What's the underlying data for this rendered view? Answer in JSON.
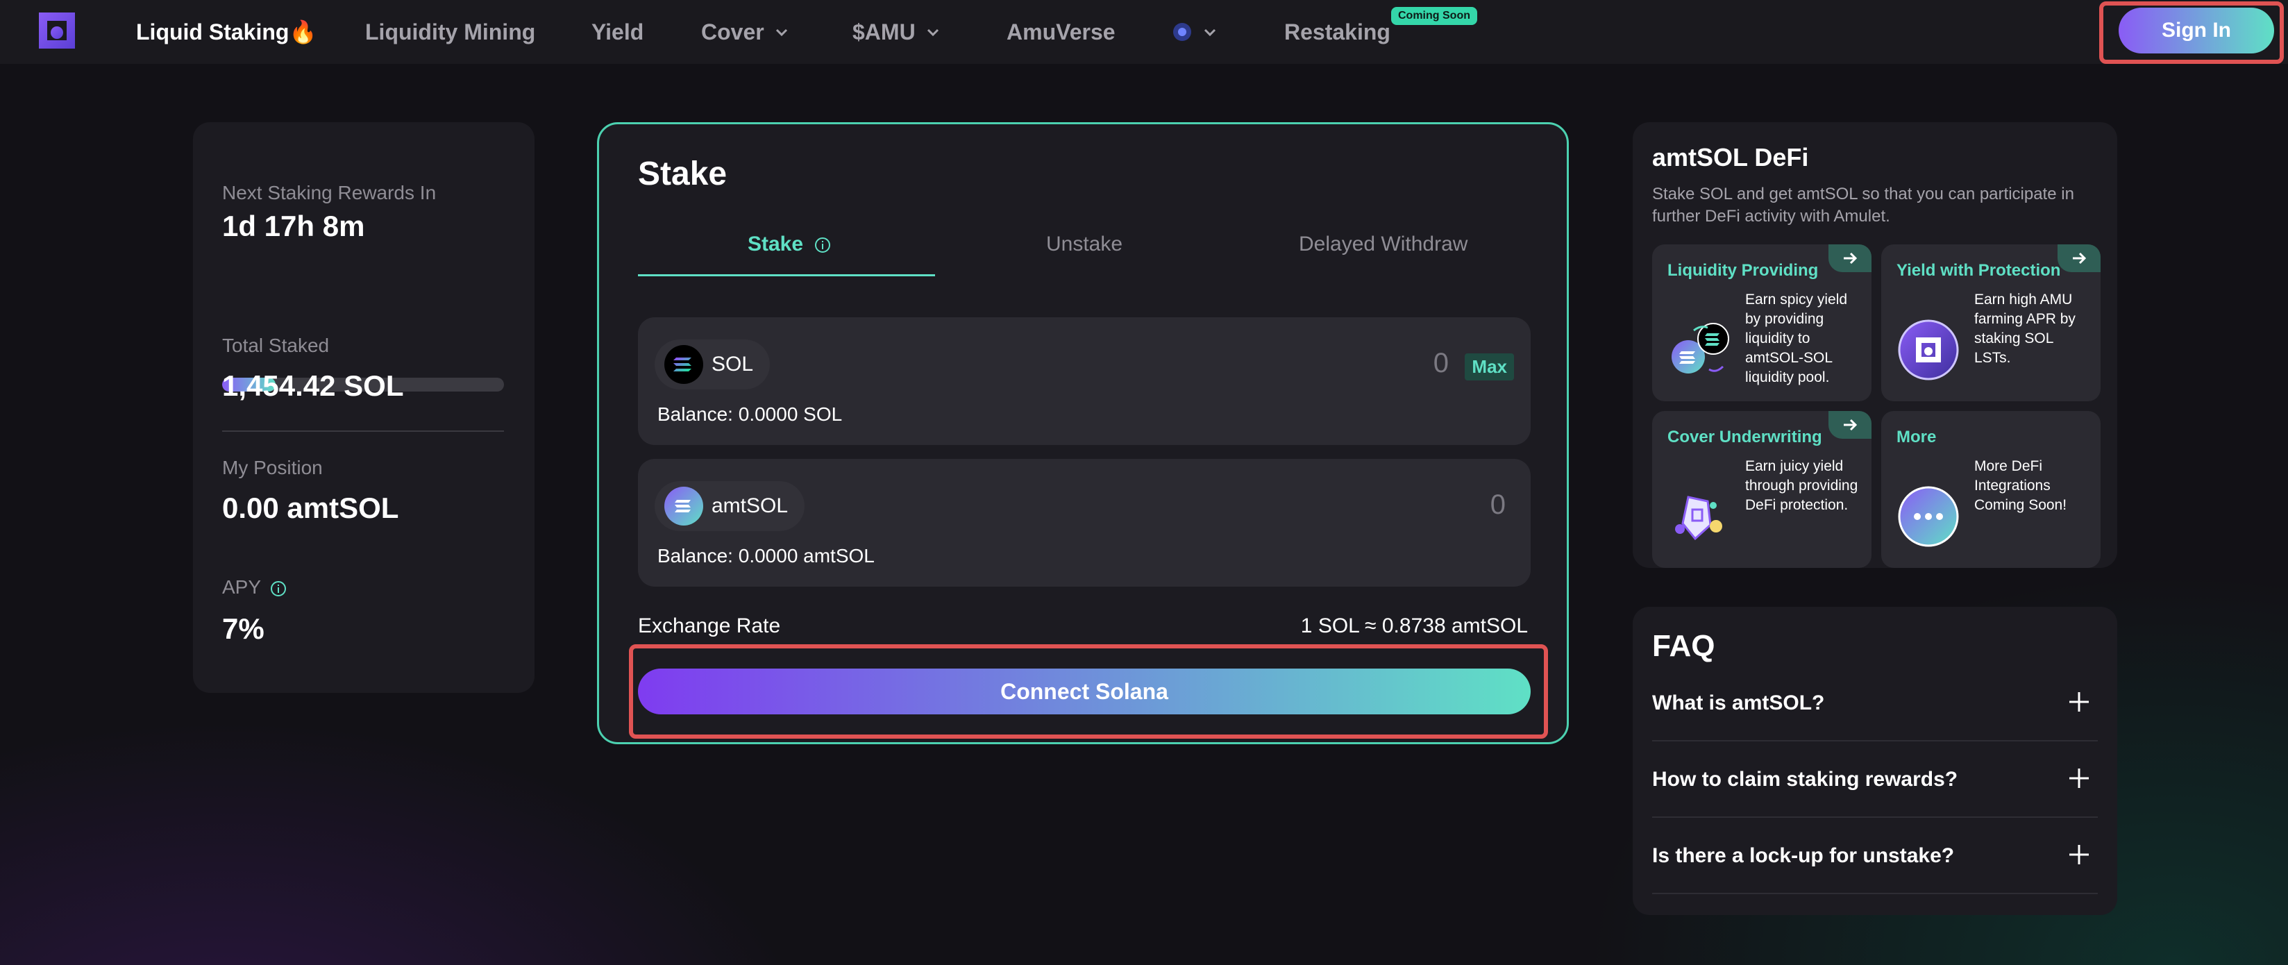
{
  "nav": {
    "items": [
      {
        "label": "Liquid Staking🔥"
      },
      {
        "label": "Liquidity Mining"
      },
      {
        "label": "Yield"
      },
      {
        "label": "Cover"
      },
      {
        "label": "$AMU"
      },
      {
        "label": "AmuVerse"
      },
      {
        "label": ""
      },
      {
        "label": "Restaking"
      }
    ],
    "coming_soon": "Coming Soon",
    "sign_in": "Sign In"
  },
  "stats": {
    "next_rewards_label": "Next Staking Rewards In",
    "next_rewards_value": "1d 17h 8m",
    "progress": 0.19,
    "total_staked_label": "Total Staked",
    "total_staked_value": "1,454.42 SOL",
    "position_label": "My Position",
    "position_value": "0.00 amtSOL",
    "apy_label": "APY",
    "apy_value": "7%"
  },
  "stake": {
    "title": "Stake",
    "tabs": [
      "Stake",
      "Unstake",
      "Delayed Withdraw"
    ],
    "from": {
      "token": "SOL",
      "amount": "0",
      "max": "Max",
      "balance": "Balance: 0.0000 SOL"
    },
    "to": {
      "token": "amtSOL",
      "amount": "0",
      "balance": "Balance: 0.0000 amtSOL"
    },
    "exchange_rate_label": "Exchange Rate",
    "exchange_rate_value": "1 SOL ≈ 0.8738 amtSOL",
    "connect": "Connect Solana"
  },
  "defi": {
    "title": "amtSOL DeFi",
    "description": "Stake SOL and get amtSOL so that you can participate in further DeFi activity with Amulet.",
    "cards": [
      {
        "title": "Liquidity Providing",
        "text": "Earn spicy yield by providing liquidity to amtSOL-SOL liquidity pool."
      },
      {
        "title": "Yield with Protection",
        "text": "Earn high AMU farming APR by staking SOL LSTs."
      },
      {
        "title": "Cover Underwriting",
        "text": "Earn juicy yield through providing DeFi protection."
      },
      {
        "title": "More",
        "text": "More DeFi Integrations Coming Soon!"
      }
    ]
  },
  "faq": {
    "title": "FAQ",
    "questions": [
      "What is amtSOL?",
      "How to claim staking rewards?",
      "Is there a lock-up for unstake?"
    ]
  },
  "colors": {
    "accent": "#5fe0c5",
    "purple": "#8a5cf5",
    "highlight": "#e05353"
  }
}
